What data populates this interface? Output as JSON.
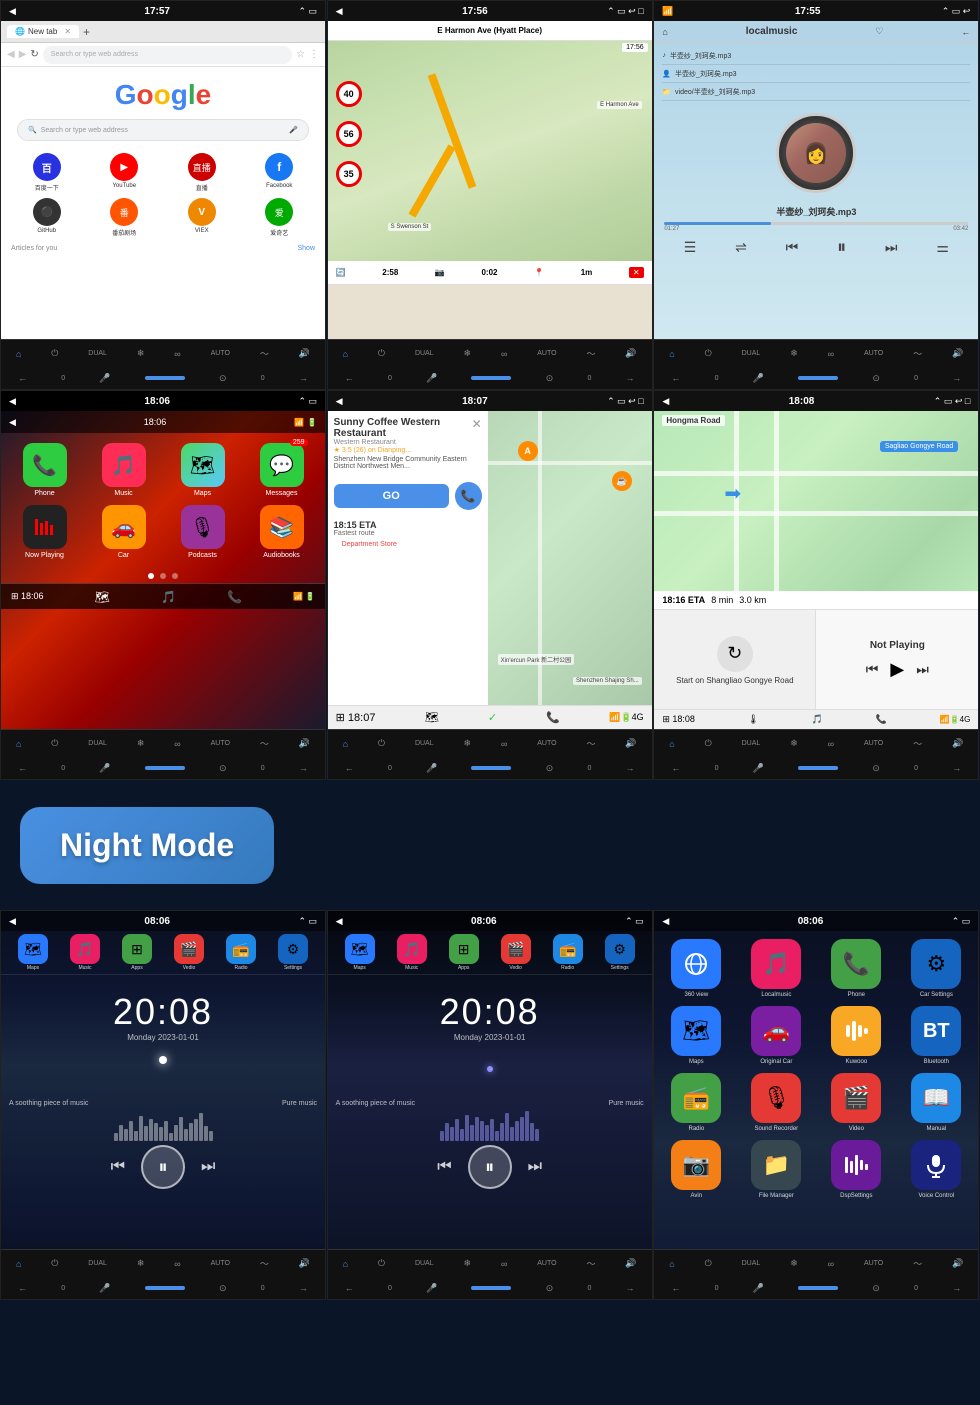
{
  "screens": {
    "s1": {
      "status_time": "17:57",
      "tab_label": "New tab",
      "url_placeholder": "Search or type web address",
      "google_text": "Google",
      "search_placeholder": "Search or type web address",
      "shortcuts": [
        {
          "label": "百度一下",
          "icon": "🔵",
          "color": "#2932e1"
        },
        {
          "label": "YouTube",
          "icon": "▶",
          "color": "#ff0000"
        },
        {
          "label": "直播",
          "icon": "📺",
          "color": "#cc0000"
        },
        {
          "label": "Facebook",
          "icon": "f",
          "color": "#1877f2"
        },
        {
          "label": "GitHub",
          "icon": "⚫",
          "color": "#333"
        },
        {
          "label": "番茄剧场",
          "icon": "🍅",
          "color": "#ff5500"
        },
        {
          "label": "VIEX",
          "icon": "V",
          "color": "#ee8800"
        },
        {
          "label": "爱奇艺",
          "icon": "🎬",
          "color": "#00cc00"
        }
      ],
      "articles_label": "Articles for you",
      "show_label": "Show"
    },
    "s2": {
      "status_time": "17:56",
      "nav_header": "E Harmon Ave (Hyatt Place)",
      "eta1": "2:58",
      "eta2": "0:02",
      "eta3": "1m",
      "speed1": "40",
      "speed2": "56",
      "speed3": "35"
    },
    "s3": {
      "status_time": "17:55",
      "title": "localmusic",
      "track1": "半壶纱_刘珂矣.mp3",
      "track2": "半壶纱_刘珂矣.mp3",
      "track3": "video/半壶纱_刘珂矣.mp3",
      "current_track": "半壶纱_刘珂矣.mp3",
      "time_current": "01:27",
      "time_total": "03:42"
    },
    "s4": {
      "status_time": "18:06",
      "clock": "18:06",
      "apps": [
        {
          "label": "Phone",
          "icon": "📞",
          "color": "#2ecc40"
        },
        {
          "label": "Music",
          "icon": "🎵",
          "color": "#ff2d55"
        },
        {
          "label": "Maps",
          "icon": "🗺",
          "color": "#ff6b35"
        },
        {
          "label": "Messages",
          "icon": "💬",
          "color": "#2ecc40",
          "badge": "259"
        },
        {
          "label": "Now Playing",
          "icon": "🎙",
          "color": "#1a1a1a"
        },
        {
          "label": "Car",
          "icon": "🚗",
          "color": "#ff9500"
        },
        {
          "label": "Podcasts",
          "icon": "🎙",
          "color": "#993399"
        },
        {
          "label": "Audiobooks",
          "icon": "📚",
          "color": "#ff6600"
        }
      ]
    },
    "s5": {
      "status_time": "18:07",
      "poi_name": "Sunny Coffee Western Restaurant",
      "poi_type": "Western Restaurant",
      "poi_rating": "★ 3.5 (26) on Dianping...",
      "poi_address": "Shenzhen New Bridge Community Eastern District Northwest Men...",
      "eta_label": "18:15 ETA",
      "route_label": "Fastest route",
      "go_label": "GO",
      "bottom_label": "Department Store"
    },
    "s6": {
      "status_time": "18:08",
      "road_label": "Sagliao Gongye Road",
      "eta": "18:16 ETA",
      "eta_time": "8 min",
      "eta_dist": "3.0 km",
      "start_label": "Start on Shangliao Gongye Road",
      "not_playing": "Not Playing"
    },
    "night_banner": "Night Mode",
    "n1": {
      "status_time": "08:06",
      "apps": [
        "Maps",
        "Music",
        "Apps",
        "Vedio",
        "Radio",
        "Settings"
      ],
      "app_icons": [
        "🗺",
        "🎵",
        "⊞",
        "🎬",
        "📻",
        "⚙"
      ],
      "app_colors": [
        "#2979ff",
        "#e91e63",
        "#43a047",
        "#e53935",
        "#1e88e5",
        "#1565c0"
      ],
      "clock": "20:08",
      "date": "Monday  2023-01-01",
      "song1": "A soothing piece of music",
      "song2": "Pure music"
    },
    "n2": {
      "status_time": "08:06",
      "apps": [
        "Maps",
        "Music",
        "Apps",
        "Vedio",
        "Radio",
        "Settings"
      ],
      "clock": "20:08",
      "date": "Monday  2023-01-01",
      "song1": "A soothing piece of music",
      "song2": "Pure music"
    },
    "n3": {
      "status_time": "08:06",
      "apps": [
        {
          "label": "360 view",
          "color": "#2979ff"
        },
        {
          "label": "Localmusic",
          "color": "#e91e63"
        },
        {
          "label": "Phone",
          "color": "#43a047"
        },
        {
          "label": "Car Settings",
          "color": "#1565c0"
        },
        {
          "label": "Maps",
          "color": "#2979ff"
        },
        {
          "label": "Original Car",
          "color": "#7b1fa2"
        },
        {
          "label": "Kuwooo",
          "color": "#f9a825"
        },
        {
          "label": "Bluetooth",
          "color": "#1565c0"
        },
        {
          "label": "Radio",
          "color": "#43a047"
        },
        {
          "label": "Sound Recorder",
          "color": "#e53935"
        },
        {
          "label": "Video",
          "color": "#e53935"
        },
        {
          "label": "Manual",
          "color": "#1e88e5"
        },
        {
          "label": "Avin",
          "color": "#f57f17"
        },
        {
          "label": "File Manager",
          "color": "#37474f"
        },
        {
          "label": "DspSettings",
          "color": "#6a1b9a"
        },
        {
          "label": "Voice Control",
          "color": "#1a237e"
        }
      ]
    }
  }
}
